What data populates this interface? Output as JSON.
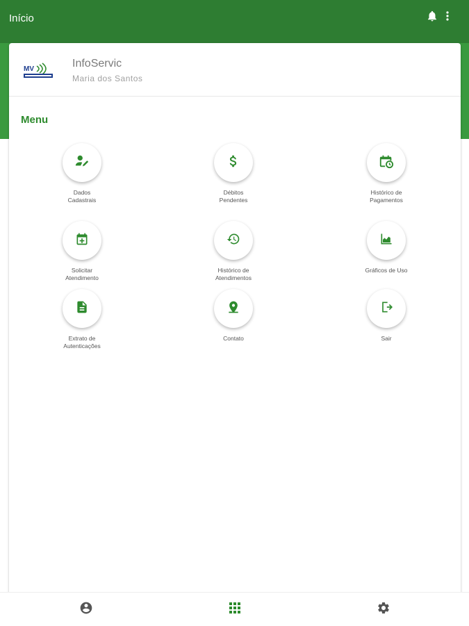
{
  "header": {
    "title": "Início"
  },
  "profile": {
    "company": "InfoServic",
    "user": "Maria dos Santos",
    "logo_text": "MV"
  },
  "menu": {
    "title": "Menu",
    "items": [
      {
        "label": "Dados\nCadastrais",
        "icon": "user-edit-icon"
      },
      {
        "label": "Débitos\nPendentes",
        "icon": "dollar-icon"
      },
      {
        "label": "Histórico de\nPagamentos",
        "icon": "calendar-clock-icon"
      },
      {
        "label": "Solicitar\nAtendimento",
        "icon": "calendar-plus-icon"
      },
      {
        "label": "Histórico de\nAtendimentos",
        "icon": "history-icon"
      },
      {
        "label": "Gráficos de Uso",
        "icon": "chart-icon"
      },
      {
        "label": "Extrato de\nAutenticações",
        "icon": "document-icon"
      },
      {
        "label": "Contato",
        "icon": "location-icon"
      },
      {
        "label": "Sair",
        "icon": "logout-icon"
      }
    ]
  },
  "bottom_nav": {
    "items": [
      {
        "icon": "account-icon"
      },
      {
        "icon": "grid-icon",
        "active": true
      },
      {
        "icon": "settings-icon"
      }
    ]
  },
  "colors": {
    "primary_dark": "#2e7d32",
    "primary": "#3a9a3f",
    "icon_green": "#2e8b2e"
  }
}
